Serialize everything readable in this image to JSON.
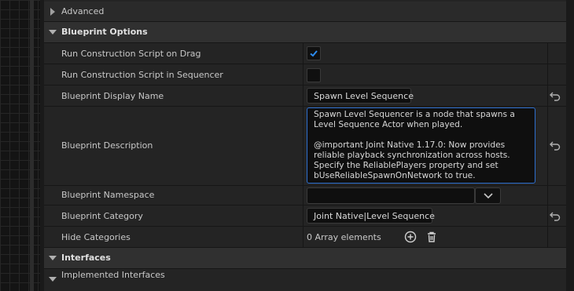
{
  "categories": {
    "advanced": "Advanced",
    "blueprint_options": "Blueprint Options",
    "interfaces": "Interfaces"
  },
  "props": {
    "run_on_drag": {
      "label": "Run Construction Script on Drag",
      "checked": true
    },
    "run_in_sequencer": {
      "label": "Run Construction Script in Sequencer",
      "checked": false
    },
    "display_name": {
      "label": "Blueprint Display Name",
      "value": "Spawn Level Sequence"
    },
    "description": {
      "label": "Blueprint Description",
      "value": "Spawn Level Sequencer is a node that spawns a Level Sequence Actor when played.\n\n@important Joint Native 1.17.0: Now provides reliable playback synchronization across hosts. Specify the ReliablePlayers property and set bUseReliableSpawnOnNetwork to true."
    },
    "namespace": {
      "label": "Blueprint Namespace",
      "value": ""
    },
    "category": {
      "label": "Blueprint Category",
      "value": "Joint Native|Level Sequence"
    },
    "hide_categories": {
      "label": "Hide Categories",
      "value": "0 Array elements"
    },
    "implemented_interfaces": {
      "label": "Implemented Interfaces"
    }
  },
  "icons": {
    "reset": "reset-arrow-icon",
    "add": "add-circle-icon",
    "delete": "trash-icon",
    "dropdown": "chevron-down-icon",
    "check": "checkmark-icon"
  },
  "colors": {
    "accent": "#2d6fcf",
    "panel": "#242424",
    "category": "#303030"
  }
}
